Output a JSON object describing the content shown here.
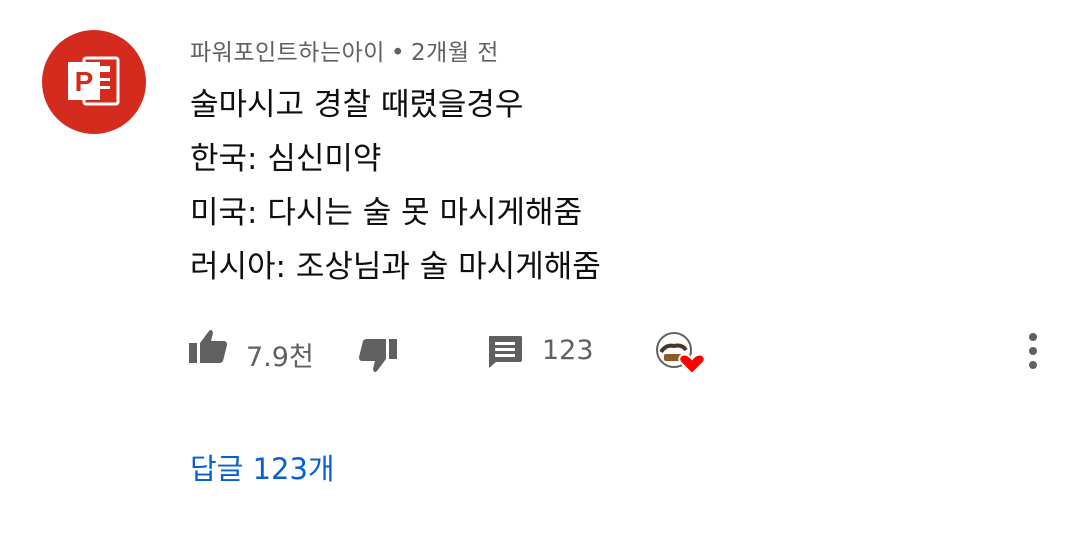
{
  "comment": {
    "author": "파워포인트하는아이",
    "separator": "•",
    "time": "2개월 전",
    "lines": [
      "술마시고 경찰 때렸을경우",
      "한국: 심신미약",
      "미국: 다시는 술 못 마시게해줌",
      "러시아: 조상님과 술 마시게해줌"
    ]
  },
  "actions": {
    "like_count": "7.9천",
    "reply_count": "123"
  },
  "replies_label": "답글 123개",
  "colors": {
    "avatar_bg": "#d42b1e",
    "icon_gray": "#606060",
    "link_blue": "#065fd4",
    "heart_red": "#ff0000"
  },
  "icons": {
    "avatar": "powerpoint-logo",
    "like": "thumbs-up-icon",
    "dislike": "thumbs-down-icon",
    "reply": "comment-icon",
    "creator_heart": "creator-heart-icon",
    "menu": "more-vertical-icon"
  }
}
